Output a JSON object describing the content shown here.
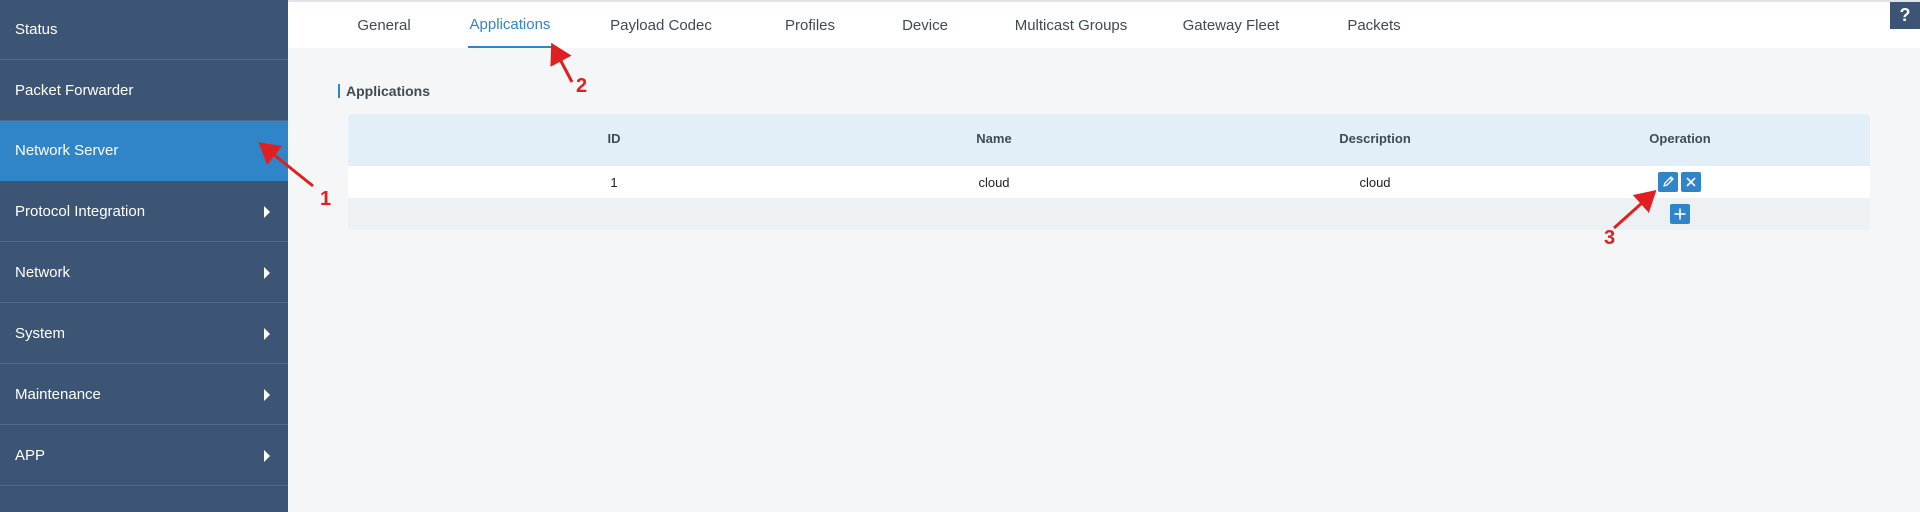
{
  "sidebar": {
    "items": [
      {
        "label": "Status",
        "has_submenu": false,
        "active": false
      },
      {
        "label": "Packet Forwarder",
        "has_submenu": false,
        "active": false
      },
      {
        "label": "Network Server",
        "has_submenu": false,
        "active": true
      },
      {
        "label": "Protocol Integration",
        "has_submenu": true,
        "active": false
      },
      {
        "label": "Network",
        "has_submenu": true,
        "active": false
      },
      {
        "label": "System",
        "has_submenu": true,
        "active": false
      },
      {
        "label": "Maintenance",
        "has_submenu": true,
        "active": false
      },
      {
        "label": "APP",
        "has_submenu": true,
        "active": false
      }
    ]
  },
  "tabs": [
    {
      "label": "General",
      "active": false
    },
    {
      "label": "Applications",
      "active": true
    },
    {
      "label": "Payload Codec",
      "active": false
    },
    {
      "label": "Profiles",
      "active": false
    },
    {
      "label": "Device",
      "active": false
    },
    {
      "label": "Multicast Groups",
      "active": false
    },
    {
      "label": "Gateway Fleet",
      "active": false
    },
    {
      "label": "Packets",
      "active": false
    }
  ],
  "help_label": "?",
  "section": {
    "title": "Applications"
  },
  "table": {
    "columns": [
      "ID",
      "Name",
      "Description",
      "Operation"
    ],
    "rows": [
      {
        "id": "1",
        "name": "cloud",
        "description": "cloud"
      }
    ]
  },
  "annotations": [
    "1",
    "2",
    "3"
  ],
  "colors": {
    "sidebar_bg": "#3c5575",
    "accent": "#2f85c8",
    "annotation": "#e02020"
  }
}
